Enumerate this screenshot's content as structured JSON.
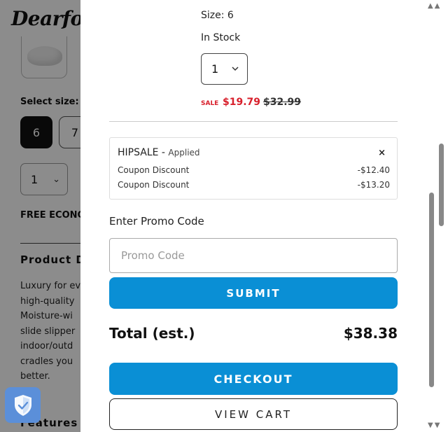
{
  "background": {
    "logo": "Dearfoa",
    "select_size_label": "Select size:",
    "sizes": [
      "6",
      "7"
    ],
    "quantity": "1",
    "shipping_text": "FREE ECONO",
    "product_title": "Product D",
    "description_lines": [
      "Luxury for ev",
      "high-quality",
      "Moisture-wi",
      "slide slipper",
      "indoor/outd",
      "cradles you",
      "better."
    ],
    "features_title": "Features"
  },
  "drawer": {
    "size": "Size: 6",
    "stock": "In Stock",
    "quantity": "1",
    "sale_tag": "SALE",
    "sale_price": "$19.79",
    "original_price": "$32.99",
    "coupon": {
      "code": "HIPSALE",
      "separator": " - ",
      "status": "Applied",
      "remove_symbol": "×",
      "rows": [
        {
          "label": "Coupon Discount",
          "value": "-$12.40"
        },
        {
          "label": "Coupon Discount",
          "value": "-$13.20"
        }
      ]
    },
    "promo_label": "Enter Promo Code",
    "promo_placeholder": "Promo Code",
    "submit_label": "SUBMIT",
    "total_label": "Total (est.)",
    "total_value": "$38.38",
    "checkout_label": "CHECKOUT",
    "view_cart_label": "VIEW CART"
  },
  "colors": {
    "accent": "#0a8fd5",
    "sale": "#d8202c",
    "shield": "#5b8fd9"
  },
  "icons": {
    "chevron": "chevron-down-icon",
    "shield": "shield-check-icon",
    "close": "close-icon"
  }
}
